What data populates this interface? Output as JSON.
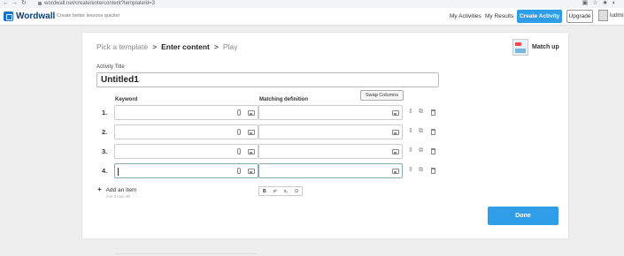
{
  "browser": {
    "url": "wordwall.net/create/entercontent?templateId=3"
  },
  "header": {
    "logo_text": "Wordwall",
    "tagline": "Create better lessons quicker",
    "my_activities": "My Activities",
    "my_results": "My Results",
    "create_activity": "Create Activity",
    "upgrade": "Upgrade",
    "user_name": "ludmi"
  },
  "steps": {
    "step1": "Pick a template",
    "step2": "Enter content",
    "step3": "Play",
    "separator": ">"
  },
  "template": {
    "name": "Match up"
  },
  "form": {
    "activity_title_label": "Activity Title",
    "activity_title_value": "Untitled1",
    "swap_columns": "Swap Columns",
    "keyword_header": "Keyword",
    "definition_header": "Matching definition",
    "rows": [
      {
        "num": "1."
      },
      {
        "num": "2."
      },
      {
        "num": "3."
      },
      {
        "num": "4."
      }
    ],
    "format_toolbar": {
      "bold": "B",
      "superscript": "x²",
      "subscript": "x₂",
      "symbol": "Ω"
    },
    "add_item": "Add an item",
    "min_max": "min 3   max 30",
    "done": "Done"
  },
  "colors": {
    "accent": "#2f9de8",
    "logo": "#0b3f78"
  }
}
